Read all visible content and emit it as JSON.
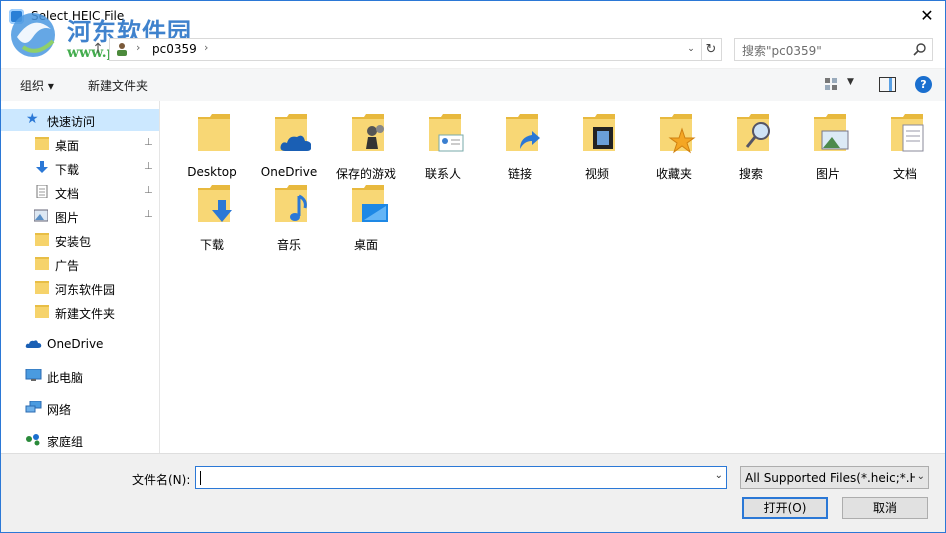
{
  "window": {
    "title": "Select HEIC File",
    "close_glyph": "✕"
  },
  "watermark": {
    "name": "河东软件园",
    "url": "www.pc0359.cn"
  },
  "address": {
    "path": "pc0359",
    "separator": "›",
    "chevron": "›",
    "dropdown_glyph": "⌄",
    "refresh_glyph": "↻",
    "up_glyph": "↑"
  },
  "search": {
    "placeholder": "搜索\"pc0359\""
  },
  "toolbar": {
    "organize": "组织 ▾",
    "new_folder": "新建文件夹",
    "help": "?"
  },
  "sidebar": {
    "quick_access": "快速访问",
    "items": [
      {
        "label": "桌面",
        "pinned": true,
        "icon": "folder-icon"
      },
      {
        "label": "下载",
        "pinned": true,
        "icon": "download-icon"
      },
      {
        "label": "文档",
        "pinned": true,
        "icon": "document-icon"
      },
      {
        "label": "图片",
        "pinned": true,
        "icon": "picture-icon"
      },
      {
        "label": "安装包",
        "pinned": false,
        "icon": "folder-icon"
      },
      {
        "label": "广告",
        "pinned": false,
        "icon": "folder-icon"
      },
      {
        "label": "河东软件园",
        "pinned": false,
        "icon": "folder-icon"
      },
      {
        "label": "新建文件夹",
        "pinned": false,
        "icon": "folder-icon"
      }
    ],
    "onedrive": "OneDrive",
    "this_pc": "此电脑",
    "network": "网络",
    "homegroup": "家庭组",
    "pin_glyph": "📌"
  },
  "folders": [
    {
      "label": "Desktop",
      "icon": "desktop-folder-icon"
    },
    {
      "label": "OneDrive",
      "icon": "onedrive-folder-icon"
    },
    {
      "label": "保存的游戏",
      "icon": "saved-games-folder-icon"
    },
    {
      "label": "联系人",
      "icon": "contacts-folder-icon"
    },
    {
      "label": "链接",
      "icon": "links-folder-icon"
    },
    {
      "label": "视频",
      "icon": "videos-folder-icon"
    },
    {
      "label": "收藏夹",
      "icon": "favorites-folder-icon"
    },
    {
      "label": "搜索",
      "icon": "searches-folder-icon"
    },
    {
      "label": "图片",
      "icon": "pictures-folder-icon"
    },
    {
      "label": "文档",
      "icon": "documents-folder-icon"
    },
    {
      "label": "下载",
      "icon": "downloads-folder-icon"
    },
    {
      "label": "音乐",
      "icon": "music-folder-icon"
    },
    {
      "label": "桌面",
      "icon": "desktop2-folder-icon"
    }
  ],
  "footer": {
    "filename_label": "文件名(N):",
    "filename_value": "",
    "filter": "All Supported Files(*.heic;*.H",
    "open": "打开(O)",
    "cancel": "取消",
    "dropdown_glyph": "⌄"
  },
  "colors": {
    "accent": "#2b78d6",
    "folder": "#f6d36b",
    "selected_bg": "#cce8ff",
    "toolbar_bg": "#f5f6f7",
    "footer_bg": "#f0f0f0"
  }
}
